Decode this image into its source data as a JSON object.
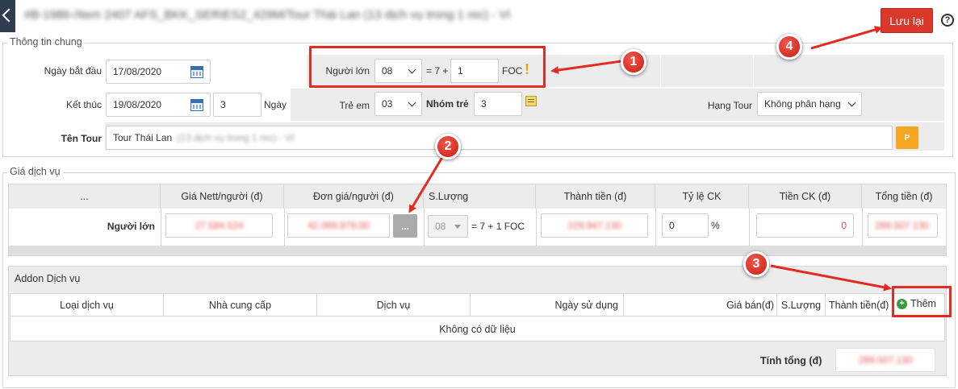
{
  "header": {
    "title": "#B-1986-/Item 2407 AFS_BKK_SERIES2_429M/Tour Thái Lan (13 dịch vụ trong 1 rec) - VI",
    "save_label": "Lưu lại",
    "help_icon": "question-circle-icon",
    "back_icon": "chevron-left-icon",
    "help_glyph": "?"
  },
  "general": {
    "legend": "Thông tin chung",
    "start_date_label": "Ngày bắt đầu",
    "start_date": "17/08/2020",
    "end_label": "Kết thúc",
    "end_date": "19/08/2020",
    "days_value": "3",
    "days_unit": "Ngày",
    "adults_label": "Người lớn",
    "adults_value": "08",
    "adults_formula": "= 7 +",
    "foc_value": "1",
    "foc_label": "FOC",
    "foc_warning": "!",
    "children_label": "Trẻ em",
    "children_value": "03",
    "child_group_label": "Nhóm trẻ",
    "child_group_value": "3",
    "tour_class_label": "Hạng Tour",
    "tour_class_value": "Không phân hạng",
    "tour_name_label": "Tên Tour",
    "tour_name_value": "Tour Thái Lan",
    "tour_name_suffix": "(13 dịch vụ trong 1 rec) - VI",
    "p_button": "P"
  },
  "pricing": {
    "legend": "Giá dịch vụ",
    "columns": [
      "...",
      "Giá Nett/người (đ)",
      "Đơn giá/người (đ)",
      "S.Lượng",
      "Thành tiền (đ)",
      "Tỷ lệ CK",
      "Tiền CK (đ)",
      "Tổng tiền (đ)"
    ],
    "row": {
      "label": "Người lớn",
      "nett_price": "27.584.524",
      "unit_price": "42.069.979.00",
      "dots_button": "...",
      "qty": "08",
      "qty_formula": "= 7 + 1 FOC",
      "amount": "229.947.130",
      "discount_rate": "0",
      "percent": "%",
      "discount_amount": "0",
      "total": "289.507.130"
    }
  },
  "addon": {
    "title": "Addon Dịch vụ",
    "columns": [
      "Loại dịch vụ",
      "Nhà cung cấp",
      "Dịch vụ",
      "Ngày sử dụng",
      "Giá bán(đ)",
      "S.Lượng",
      "Thành tiền(đ)"
    ],
    "add_label": "Thêm",
    "empty_text": "Không có dữ liệu",
    "total_label": "Tính tổng (đ)",
    "total_value": "289.507.130"
  },
  "annotations": [
    "1",
    "2",
    "3",
    "4"
  ],
  "colors": {
    "save_button": "#d9382b",
    "annotation_red": "#e32b22",
    "p_button": "#f5a623",
    "add_icon": "#3a9a3a",
    "back_button": "#2f3e4e"
  }
}
